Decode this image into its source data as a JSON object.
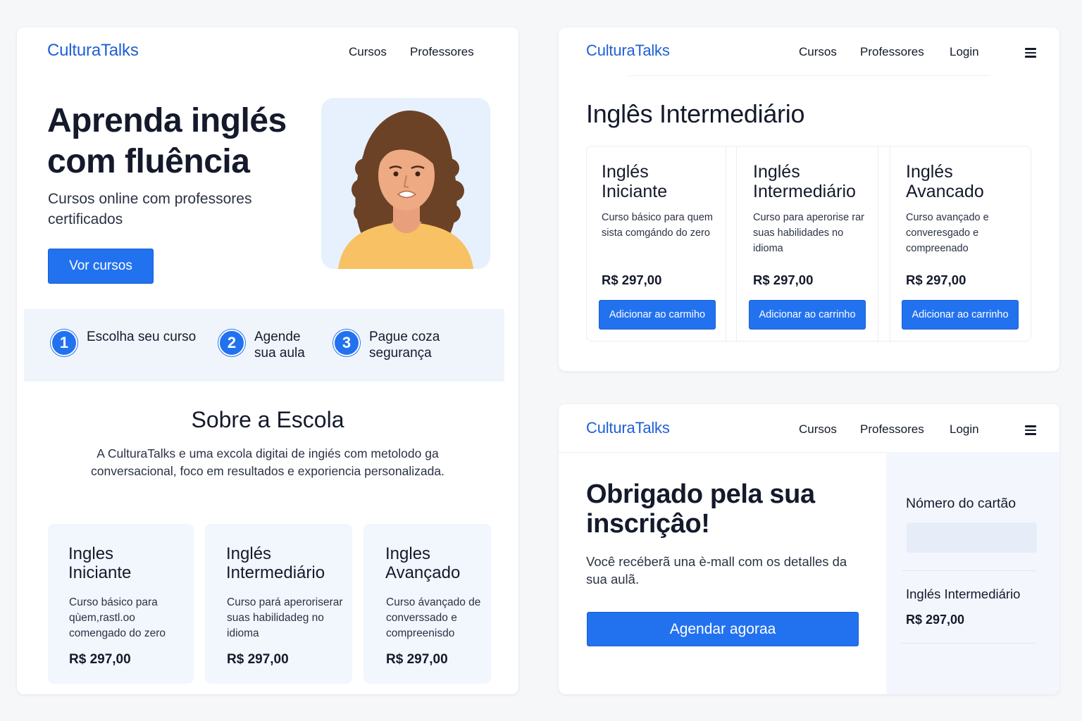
{
  "home": {
    "brand": "CulturaTalks",
    "nav": [
      "Cursos",
      "Professores"
    ],
    "hero": {
      "title": "Aprenda inglés com fluência",
      "subtitle": "Cursos online com professores certificados",
      "button": "Vor cursos"
    },
    "steps": [
      {
        "num": "1",
        "text": "Escolha seu curso"
      },
      {
        "num": "2",
        "text": "Agende sua aula"
      },
      {
        "num": "3",
        "text": "Pague coza segurança"
      }
    ],
    "about": {
      "title": "Sobre a Escola",
      "text": "A CulturaTalks e uma excola digitai de ingiés com metolodo ga conversacional, foco em resultados e exporiencia personalizada."
    },
    "courses": [
      {
        "title": "Ingles Iniciante",
        "desc": "Curso básico para qùem,rastl.oo comengado do zero",
        "price": "R$ 297,00"
      },
      {
        "title": "Inglés Intermediário",
        "desc": "Curso pará aperoriserar suas habilidadeg no idioma",
        "price": "R$ 297,00"
      },
      {
        "title": "Ingles Avançado",
        "desc": "Curso ávançado de converssado e compreenisdo",
        "price": "R$ 297,00"
      }
    ]
  },
  "courses_page": {
    "brand": "CulturaTalks",
    "nav": [
      "Cursos",
      "Professores",
      "Login"
    ],
    "title": "Inglês Intermediário",
    "cards": [
      {
        "title": "Inglés Iniciante",
        "desc": "Curso básico para quem sista comgándo do zero",
        "price": "R$ 297,00",
        "button": "Adicionar ao carmiho"
      },
      {
        "title": "Inglés Intermediário",
        "desc": "Curso para aperorise rar suas habilidades no idioma",
        "price": "R$ 297,00",
        "button": "Adicionar ao carrinho"
      },
      {
        "title": "Inglés Avancado",
        "desc": "Curso avançado e converesgado e compreenado",
        "price": "R$ 297,00",
        "button": "Adicionar ao carrinho"
      }
    ]
  },
  "thanks_page": {
    "brand": "CulturaTalks",
    "nav": [
      "Cursos",
      "Professores",
      "Login"
    ],
    "title": "Obrigado pela sua inscriçâo!",
    "text": "Você recéberã una è-mall com os detalles da sua aulã.",
    "button": "Agendar agoraa",
    "sidebar": {
      "card_label": "Nómero do cartão",
      "course": "Inglés Intermediário",
      "price": "R$ 297,00"
    }
  },
  "colors": {
    "brand": "#1f5fd6",
    "accent": "#2272f0",
    "card_bg": "#f2f6fd"
  }
}
